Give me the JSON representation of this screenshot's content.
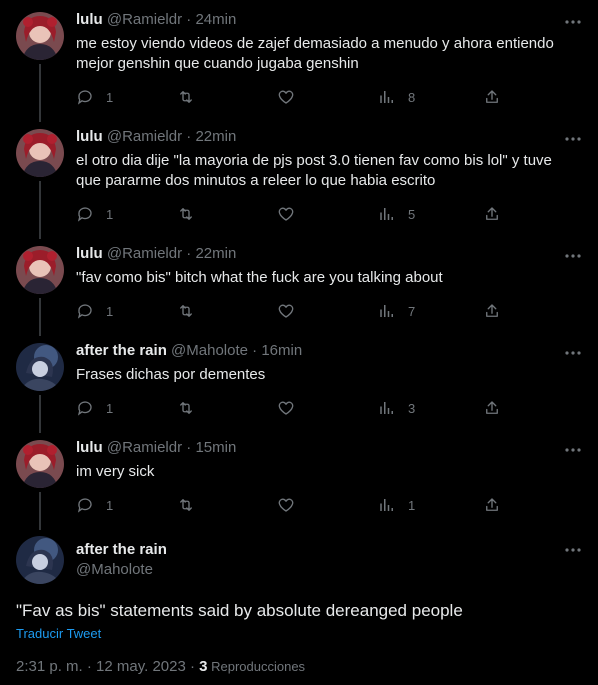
{
  "tweets": [
    {
      "name": "lulu",
      "handle": "@Ramieldr",
      "time": "24min",
      "text": "me estoy viendo videos de zajef demasiado a menudo y ahora entiendo mejor genshin que cuando jugaba genshin",
      "replies": "1",
      "retweets": "",
      "likes": "",
      "views": "8"
    },
    {
      "name": "lulu",
      "handle": "@Ramieldr",
      "time": "22min",
      "text": "el otro dia dije \"la mayoria de pjs post 3.0 tienen fav como bis lol\" y tuve que pararme dos minutos a releer lo que habia escrito",
      "replies": "1",
      "retweets": "",
      "likes": "",
      "views": "5"
    },
    {
      "name": "lulu",
      "handle": "@Ramieldr",
      "time": "22min",
      "text": "\"fav como bis\" bitch what the fuck are you talking about",
      "replies": "1",
      "retweets": "",
      "likes": "",
      "views": "7"
    },
    {
      "name": "after the rain",
      "handle": "@Maholote",
      "time": "16min",
      "text": "Frases dichas por dementes",
      "replies": "1",
      "retweets": "",
      "likes": "",
      "views": "3"
    },
    {
      "name": "lulu",
      "handle": "@Ramieldr",
      "time": "15min",
      "text": "im very sick",
      "replies": "1",
      "retweets": "",
      "likes": "",
      "views": "1"
    }
  ],
  "main": {
    "name": "after the rain",
    "handle": "@Maholote",
    "text": "\"Fav as bis\" statements said by absolute dereanged people",
    "translate": "Traducir Tweet",
    "time": "2:31 p. m. · 12 may. 2023 · ",
    "views_count": "3",
    "views_label": " Reproducciones"
  },
  "separator": " · ",
  "icons": [
    "reply-icon",
    "retweet-icon",
    "like-icon",
    "views-icon",
    "share-icon",
    "more-icon"
  ],
  "colors": {
    "background": "#000000",
    "text": "#e7e9ea",
    "secondary": "#71767b",
    "link": "#1d9bf0",
    "thread_line": "#333639"
  }
}
